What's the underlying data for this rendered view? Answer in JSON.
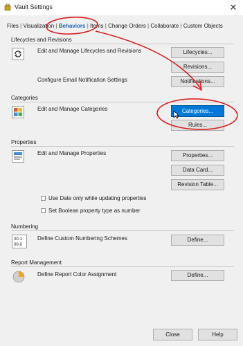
{
  "window": {
    "title": "Vault Settings",
    "close_glyph": "✕"
  },
  "tabs": [
    {
      "label": "Files"
    },
    {
      "label": "Visualization"
    },
    {
      "label": "Behaviors",
      "active": true
    },
    {
      "label": "Items"
    },
    {
      "label": "Change Orders"
    },
    {
      "label": "Collaborate"
    },
    {
      "label": "Custom Objects"
    }
  ],
  "tab_separator": "|",
  "lifecycles": {
    "title": "Lifecycles and Revisions",
    "description": "Edit and Manage Lifecycles and Revisions",
    "icon": "refresh-cycle-icon",
    "buttons": {
      "lifecycles": "Lifecycles...",
      "revisions": "Revisions..."
    },
    "email_text": "Configure Email Notification Settings",
    "notifications_button": "Notifications..."
  },
  "categories": {
    "title": "Categories",
    "description": "Edit and Manage Categories",
    "icon": "categories-grid-icon",
    "buttons": {
      "categories": "Categories...",
      "rules": "Rules..."
    }
  },
  "properties": {
    "title": "Properties",
    "description": "Edit and Manage Properties",
    "icon": "properties-form-icon",
    "buttons": {
      "properties": "Properties...",
      "data_card": "Data Card...",
      "revision_table": "Revision Table..."
    },
    "checkbox_date": "Use Date only while updating properties",
    "checkbox_boolean": "Set Boolean property type as number"
  },
  "numbering": {
    "title": "Numbering",
    "description": "Define Custom Numbering Schemes",
    "icon": "numbering-scheme-icon",
    "icon_text_top": "00-1",
    "icon_text_bottom": "00-0",
    "button": "Define..."
  },
  "report": {
    "title": "Report Management",
    "description": "Define Report Color Assignment",
    "icon": "pie-chart-icon",
    "button": "Define..."
  },
  "footer": {
    "close": "Close",
    "help": "Help"
  },
  "colors": {
    "accent": "#0078d7",
    "annotation": "#d92020",
    "active_tab": "#1a5fb4"
  }
}
